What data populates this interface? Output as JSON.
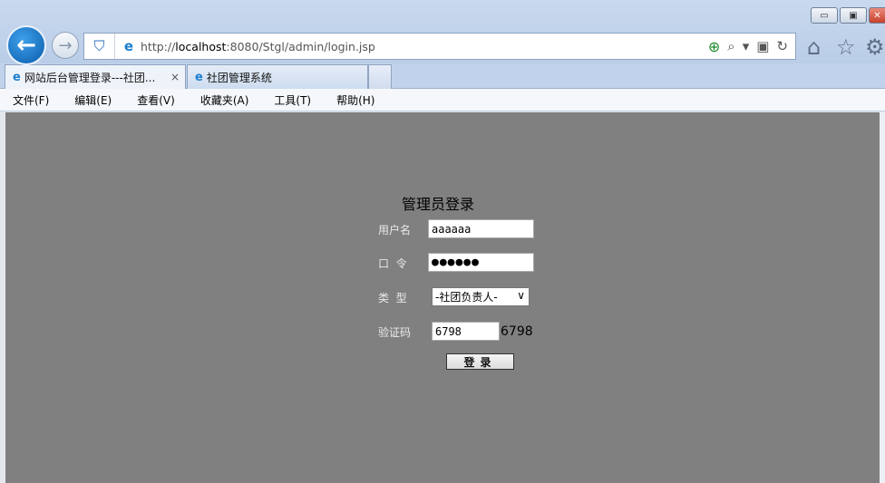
{
  "browser": {
    "url_prefix": "http://",
    "url_host": "localhost",
    "url_rest": ":8080/Stgl/admin/login.jsp",
    "tabs": [
      {
        "label": "网站后台管理登录---社团...",
        "active": true
      },
      {
        "label": "社团管理系统",
        "active": false
      }
    ],
    "menu": [
      "文件(F)",
      "编辑(E)",
      "查看(V)",
      "收藏夹(A)",
      "工具(T)",
      "帮助(H)"
    ],
    "icons": {
      "back": "←",
      "forward": "→",
      "home": "⌂",
      "favorites": "☆",
      "settings": "⚙",
      "tab_close": "×",
      "minimize": "▭",
      "restore": "▣",
      "close": "✕"
    }
  },
  "login": {
    "title": "管理员登录",
    "username_label": "用户名",
    "username_value": "aaaaaa",
    "password_label": "口  令",
    "password_value": "●●●●●●",
    "type_label": "类  型",
    "type_selected": "-社团负责人-",
    "captcha_label": "验证码",
    "captcha_input": "6798",
    "captcha_code": "6798",
    "submit_label": "登录"
  },
  "colors": {
    "content_bg": "#808080",
    "chrome_bg": "#c9d9ee"
  }
}
